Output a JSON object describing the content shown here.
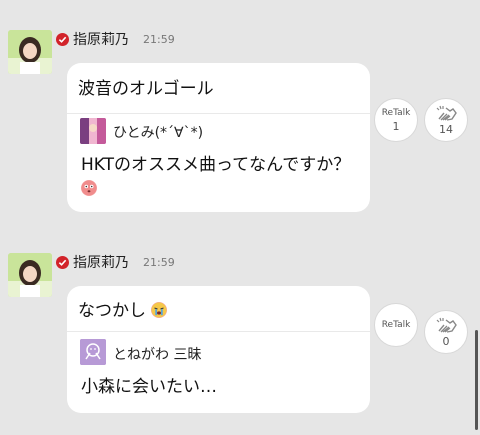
{
  "messages": [
    {
      "sender": "指原莉乃",
      "time": "21:59",
      "text": "波音のオルゴール",
      "reply": {
        "name": "ひとみ(*´∀`*)",
        "text": "HKTのオススメ曲ってなんですか？"
      },
      "retalk_label": "ReTalk",
      "retalk_count": "1",
      "like_count": "14"
    },
    {
      "sender": "指原莉乃",
      "time": "21:59",
      "text": "なつかし",
      "reply": {
        "name": "とねがわ 三昧",
        "text": "小森に会いたい…"
      },
      "retalk_label": "ReTalk",
      "retalk_count": "",
      "like_count": "0"
    }
  ],
  "colors": {
    "background": "#e6e6e6",
    "bubble": "#ffffff",
    "verified": "#d2232a",
    "reply_avatar_2": "#b79ad6"
  },
  "icons": [
    "verified-badge-icon",
    "clap-icon",
    "flushed-face-emoji",
    "crying-face-emoji",
    "default-avatar-icon"
  ]
}
